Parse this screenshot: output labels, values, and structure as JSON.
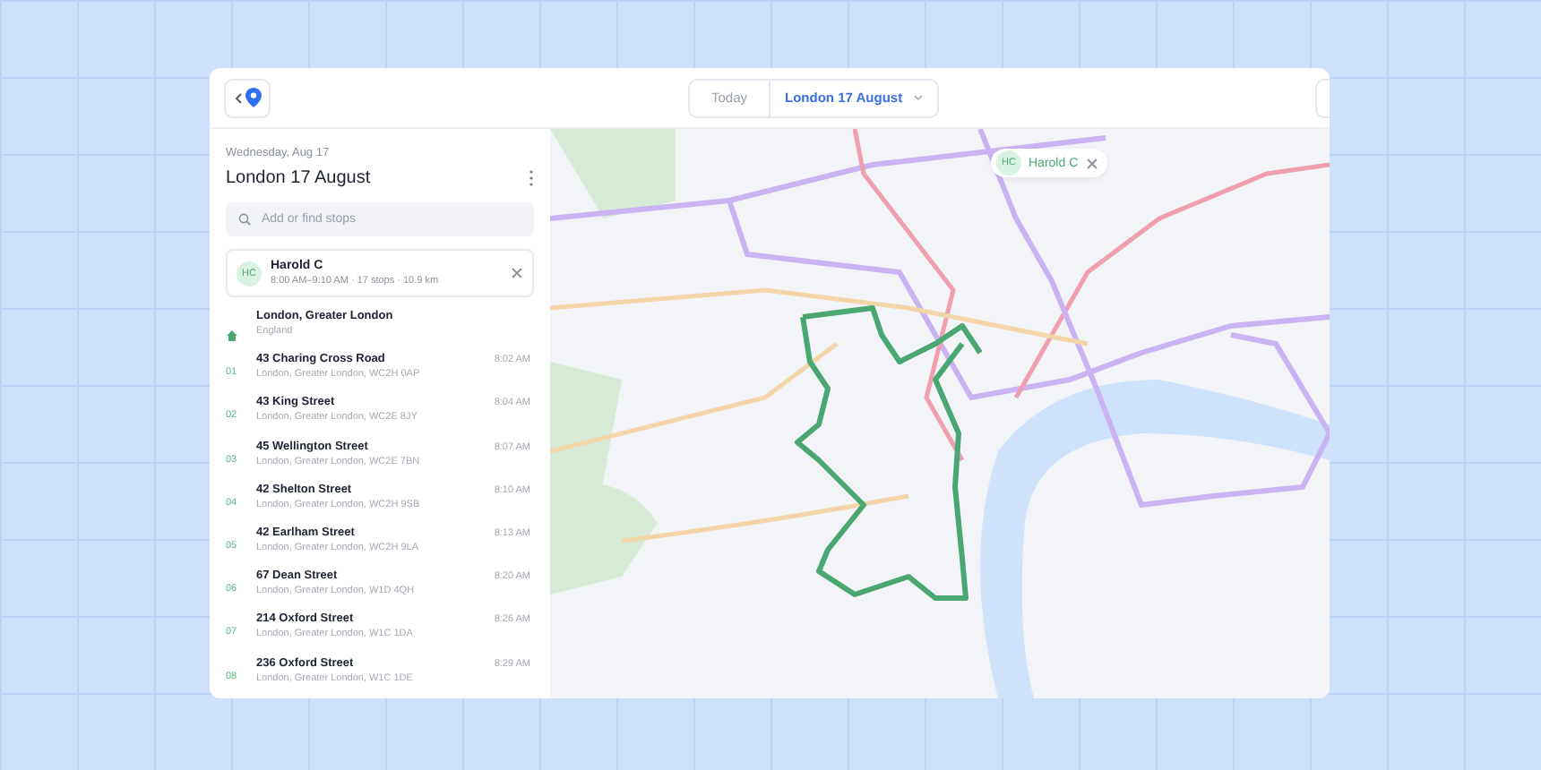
{
  "header": {
    "date_switch": [
      {
        "label": "Today",
        "selected": false
      },
      {
        "label": "London 17 August",
        "selected": true
      }
    ]
  },
  "route": {
    "date": "Wednesday, Aug 17",
    "title": "London 17 August",
    "search": {
      "placeholder": "Add or find stops"
    },
    "driver": {
      "initials": "HC",
      "name": "Harold C",
      "summary": "8:00 AM–9:10 AM · 17 stops · 10.9 km"
    },
    "start": {
      "name": "London, Greater London",
      "detail": "England"
    },
    "stops": [
      {
        "number": "01",
        "name": "43 Charing Cross Road",
        "address": "London, Greater London, WC2H 0AP",
        "time": "8:02 AM"
      },
      {
        "number": "02",
        "name": "43 King Street",
        "address": "London, Greater London, WC2E 8JY",
        "time": "8:04 AM"
      },
      {
        "number": "03",
        "name": "45 Wellington Street",
        "address": "London, Greater London, WC2E 7BN",
        "time": "8:07 AM"
      },
      {
        "number": "04",
        "name": "42 Shelton Street",
        "address": "London, Greater London, WC2H 9SB",
        "time": "8:10 AM"
      },
      {
        "number": "05",
        "name": "42 Earlham Street",
        "address": "London, Greater London, WC2H 9LA",
        "time": "8:13 AM"
      },
      {
        "number": "06",
        "name": "67 Dean Street",
        "address": "London, Greater London, W1D 4QH",
        "time": "8:20 AM"
      },
      {
        "number": "07",
        "name": "214 Oxford Street",
        "address": "London, Greater London, W1C 1DA",
        "time": "8:26 AM"
      },
      {
        "number": "08",
        "name": "236 Oxford Street",
        "address": "London, Greater London, W1C 1DE",
        "time": "8:29 AM"
      }
    ]
  },
  "map": {
    "driver_chip": {
      "initials": "HC",
      "name": "Harold C"
    }
  }
}
